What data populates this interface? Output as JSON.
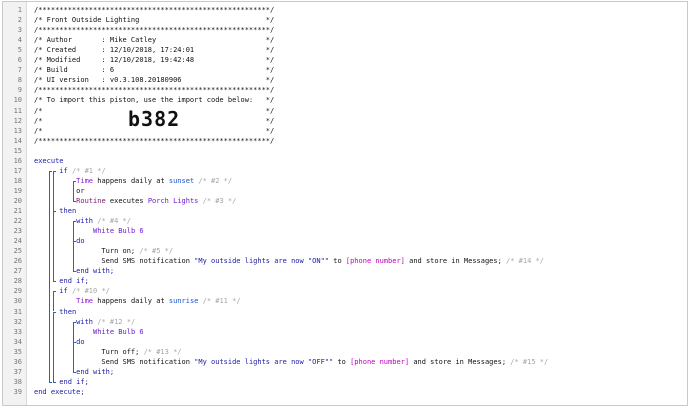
{
  "lines": [
    {
      "n": "1",
      "s": [
        [
          "t",
          "/*******************************************************/"
        ]
      ]
    },
    {
      "n": "2",
      "s": [
        [
          "t",
          "/* Front Outside Lighting                              */"
        ]
      ]
    },
    {
      "n": "3",
      "s": [
        [
          "t",
          "/*******************************************************/"
        ]
      ]
    },
    {
      "n": "4",
      "s": [
        [
          "t",
          "/* Author       : Mike Catley                          */"
        ]
      ]
    },
    {
      "n": "5",
      "s": [
        [
          "t",
          "/* Created      : 12/10/2018, 17:24:01                 */"
        ]
      ]
    },
    {
      "n": "6",
      "s": [
        [
          "t",
          "/* Modified     : 12/10/2018, 19:42:48                 */"
        ]
      ]
    },
    {
      "n": "7",
      "s": [
        [
          "t",
          "/* Build        : 6                                    */"
        ]
      ]
    },
    {
      "n": "8",
      "s": [
        [
          "t",
          "/* UI version   : v0.3.108.20180906                    */"
        ]
      ]
    },
    {
      "n": "9",
      "s": [
        [
          "t",
          "/*******************************************************/"
        ]
      ]
    },
    {
      "n": "10",
      "s": [
        [
          "t",
          "/* To import this piston, use the import code below:   */"
        ]
      ]
    },
    {
      "n": "11",
      "s": [
        [
          "t",
          "/*                                                     */"
        ]
      ]
    },
    {
      "n": "12",
      "s": [
        [
          "t",
          "/*                                                     */"
        ]
      ]
    },
    {
      "n": "13",
      "s": [
        [
          "t",
          "/*                                                     */"
        ]
      ]
    },
    {
      "n": "14",
      "s": [
        [
          "t",
          "/*******************************************************/"
        ]
      ]
    },
    {
      "n": "15",
      "s": []
    },
    {
      "n": "16",
      "s": [
        [
          "kw",
          "execute"
        ]
      ]
    },
    {
      "n": "17",
      "s": [
        [
          "t",
          "      "
        ],
        [
          "kw",
          "if"
        ],
        [
          "com",
          " /* #1 */"
        ]
      ]
    },
    {
      "n": "18",
      "s": [
        [
          "t",
          "          "
        ],
        [
          "pur",
          "Time"
        ],
        [
          "t",
          " happens daily at "
        ],
        [
          "val",
          "sunset"
        ],
        [
          "com",
          " /* #2 */"
        ]
      ]
    },
    {
      "n": "19",
      "s": [
        [
          "t",
          "          or"
        ]
      ]
    },
    {
      "n": "20",
      "s": [
        [
          "t",
          "          "
        ],
        [
          "op",
          "Routine"
        ],
        [
          "t",
          " executes "
        ],
        [
          "dev",
          "Porch Lights"
        ],
        [
          "com",
          " /* #3 */"
        ]
      ]
    },
    {
      "n": "21",
      "s": [
        [
          "t",
          "      "
        ],
        [
          "kw",
          "then"
        ]
      ]
    },
    {
      "n": "22",
      "s": [
        [
          "t",
          "          "
        ],
        [
          "kw",
          "with"
        ],
        [
          "com",
          " /* #4 */"
        ]
      ]
    },
    {
      "n": "23",
      "s": [
        [
          "t",
          "              "
        ],
        [
          "dev",
          "White Bulb 6"
        ]
      ]
    },
    {
      "n": "24",
      "s": [
        [
          "t",
          "          "
        ],
        [
          "kw",
          "do"
        ]
      ]
    },
    {
      "n": "25",
      "s": [
        [
          "t",
          "                Turn on;"
        ],
        [
          "com",
          " /* #5 */"
        ]
      ]
    },
    {
      "n": "26",
      "s": [
        [
          "t",
          "                Send SMS notification "
        ],
        [
          "str",
          "\"My outside lights are now \"ON\"\""
        ],
        [
          "t",
          " to "
        ],
        [
          "var",
          "[phone number]"
        ],
        [
          "t",
          " and store in Messages;"
        ],
        [
          "com",
          " /* #14 */"
        ]
      ]
    },
    {
      "n": "27",
      "s": [
        [
          "t",
          "          "
        ],
        [
          "kw",
          "end with;"
        ]
      ]
    },
    {
      "n": "28",
      "s": [
        [
          "t",
          "      "
        ],
        [
          "kw",
          "end if;"
        ]
      ]
    },
    {
      "n": "29",
      "s": [
        [
          "t",
          "      "
        ],
        [
          "kw",
          "if"
        ],
        [
          "com",
          " /* #10 */"
        ]
      ]
    },
    {
      "n": "30",
      "s": [
        [
          "t",
          "          "
        ],
        [
          "pur",
          "Time"
        ],
        [
          "t",
          " happens daily at "
        ],
        [
          "val",
          "sunrise"
        ],
        [
          "com",
          " /* #11 */"
        ]
      ]
    },
    {
      "n": "31",
      "s": [
        [
          "t",
          "      "
        ],
        [
          "kw",
          "then"
        ]
      ]
    },
    {
      "n": "32",
      "s": [
        [
          "t",
          "          "
        ],
        [
          "kw",
          "with"
        ],
        [
          "com",
          " /* #12 */"
        ]
      ]
    },
    {
      "n": "33",
      "s": [
        [
          "t",
          "              "
        ],
        [
          "dev",
          "White Bulb 6"
        ]
      ]
    },
    {
      "n": "34",
      "s": [
        [
          "t",
          "          "
        ],
        [
          "kw",
          "do"
        ]
      ]
    },
    {
      "n": "35",
      "s": [
        [
          "t",
          "                Turn off;"
        ],
        [
          "com",
          " /* #13 */"
        ]
      ]
    },
    {
      "n": "36",
      "s": [
        [
          "t",
          "                Send SMS notification "
        ],
        [
          "str",
          "\"My outside lights are now \"OFF\"\""
        ],
        [
          "t",
          " to "
        ],
        [
          "var",
          "[phone number]"
        ],
        [
          "t",
          " and store in Messages;"
        ],
        [
          "com",
          " /* #15 */"
        ]
      ]
    },
    {
      "n": "37",
      "s": [
        [
          "t",
          "          "
        ],
        [
          "kw",
          "end with;"
        ]
      ]
    },
    {
      "n": "38",
      "s": [
        [
          "t",
          "      "
        ],
        [
          "kw",
          "end if;"
        ]
      ]
    },
    {
      "n": "39",
      "s": [
        [
          "kw",
          "end execute;"
        ]
      ]
    }
  ],
  "import_code": "b382",
  "colors": {
    "keyword": "#1a1aa6",
    "value": "#1a52d0",
    "device": "#6b1ad1",
    "variable": "#c000c0",
    "comment": "#a5a5a5",
    "block_line": "#2a62c4"
  }
}
